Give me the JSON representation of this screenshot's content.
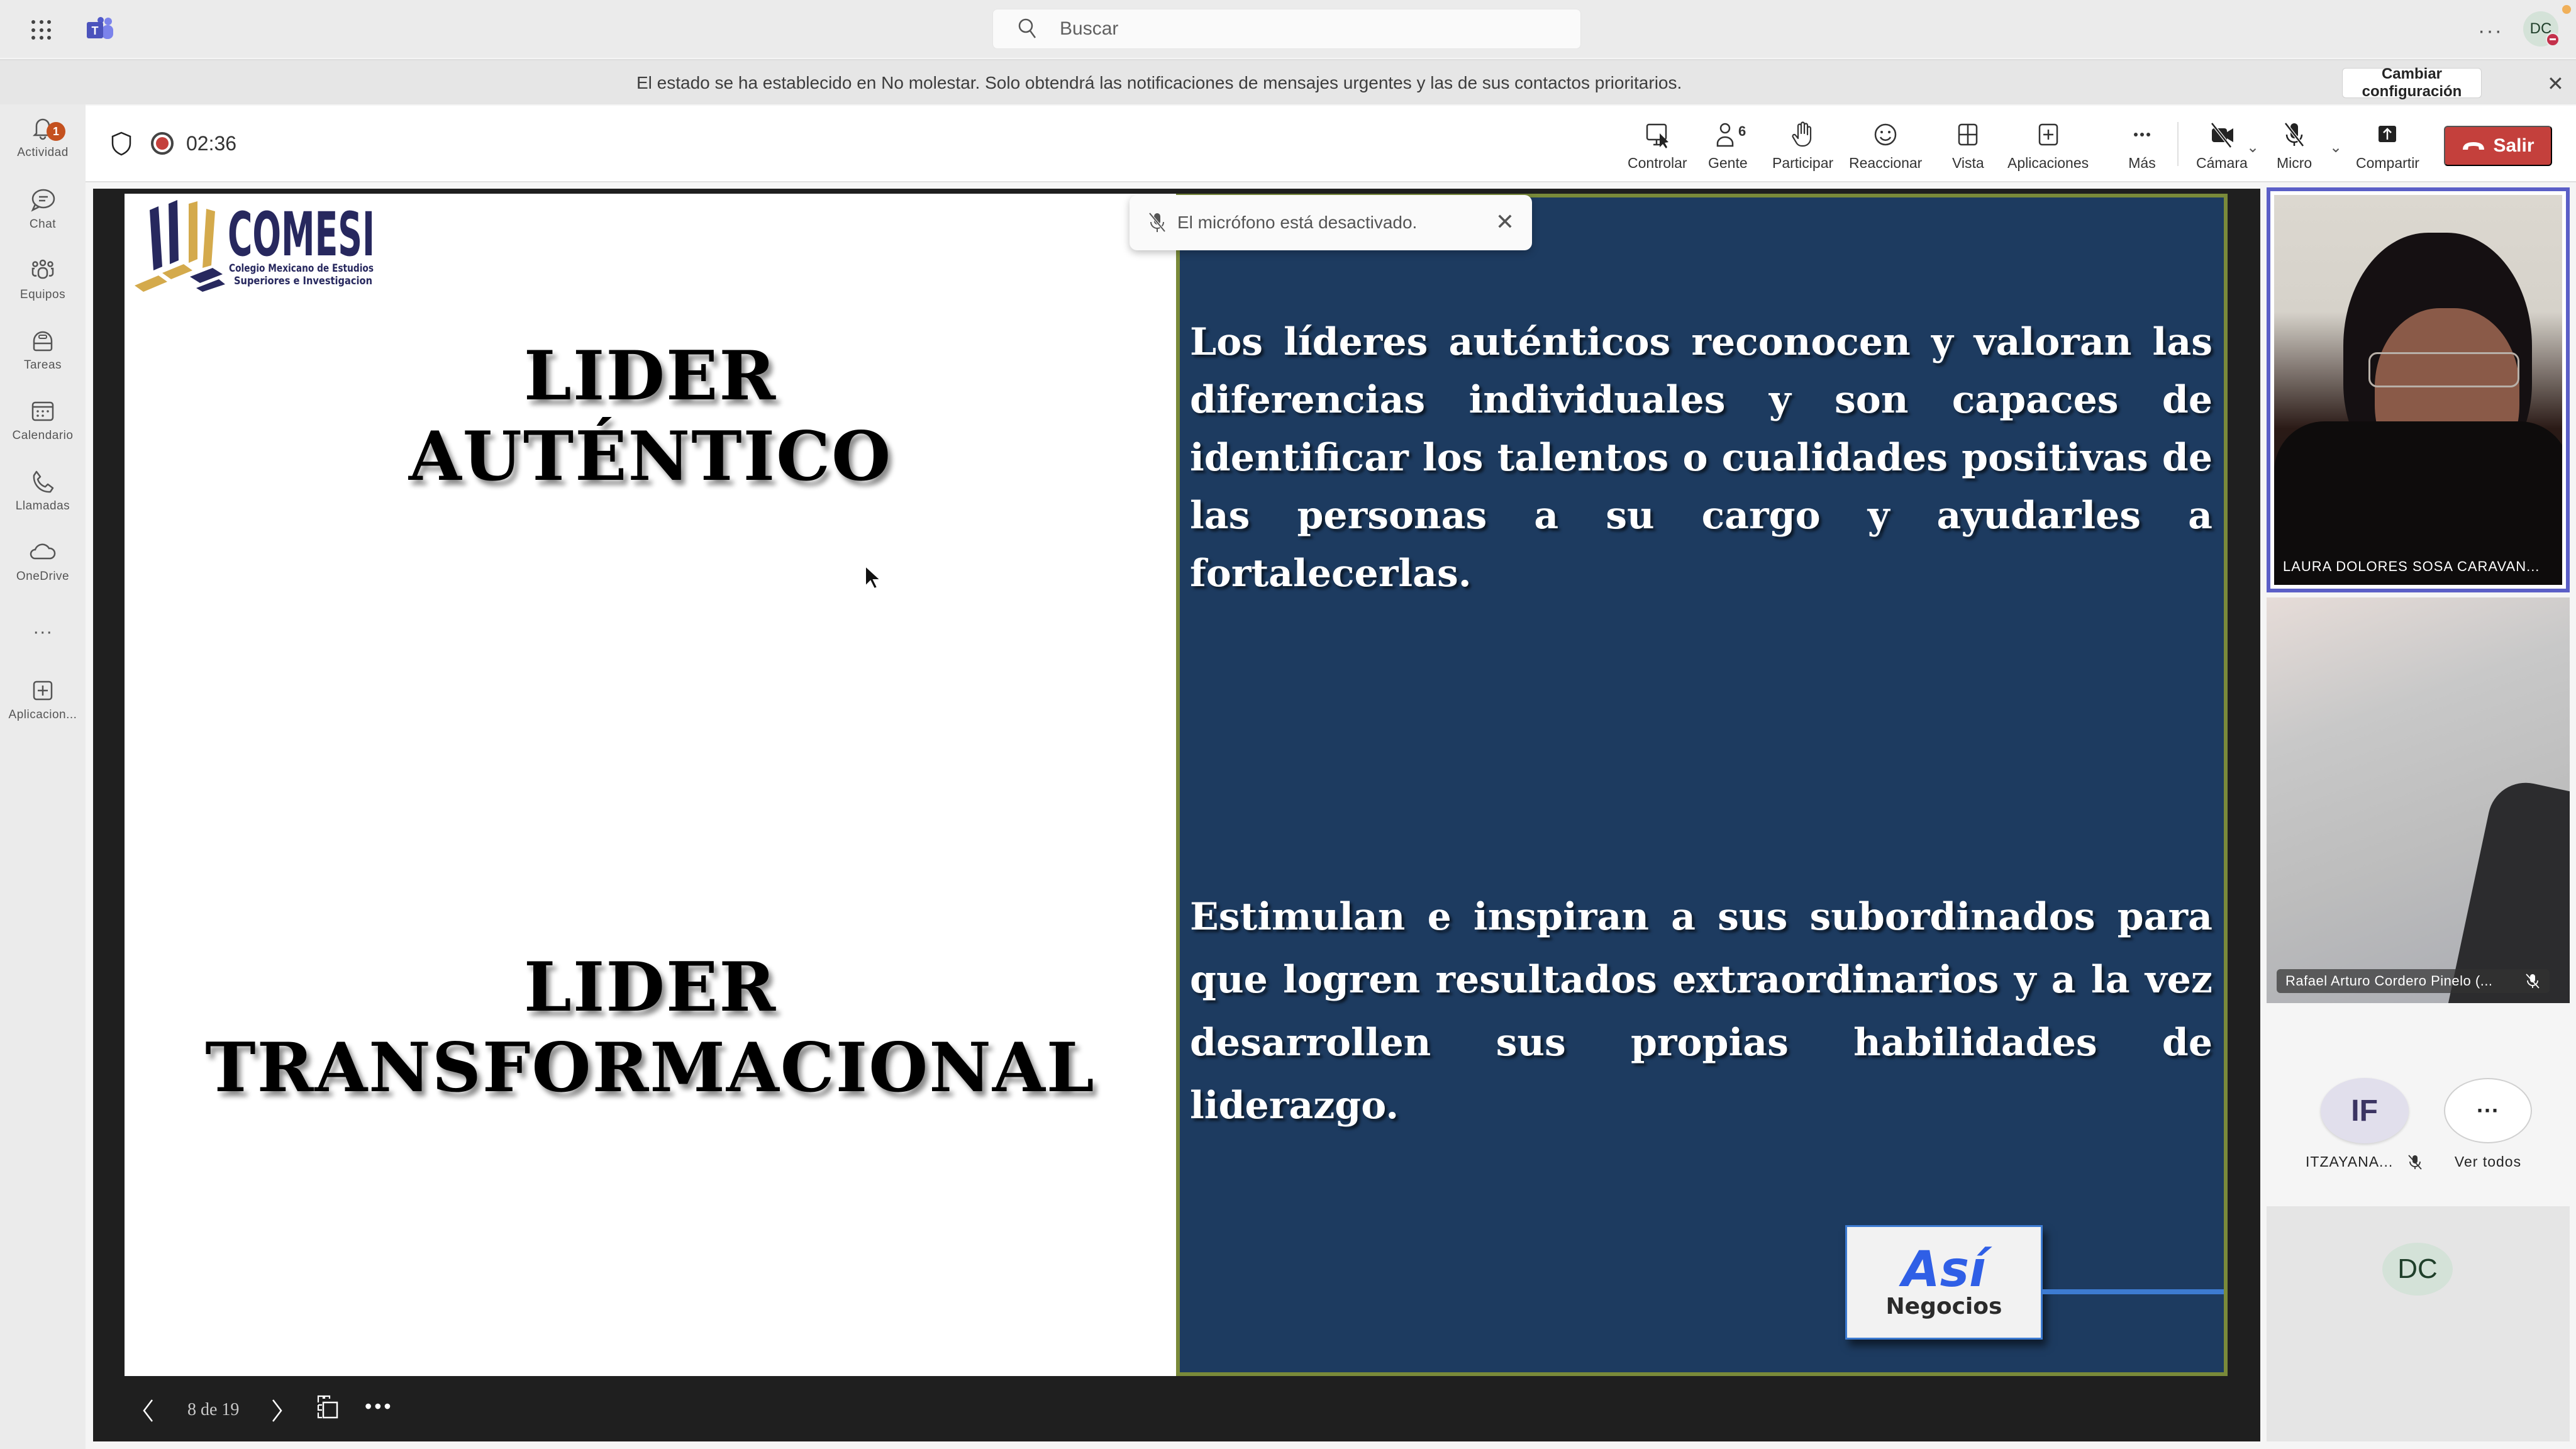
{
  "app": {
    "search_placeholder": "Buscar",
    "user_initials": "DC",
    "more_label": "···"
  },
  "banner": {
    "text": "El estado se ha establecido en No molestar. Solo obtendrá las notificaciones de mensajes urgentes y las de sus contactos prioritarios.",
    "button": "Cambiar configuración",
    "close": "✕"
  },
  "rail": {
    "items": [
      {
        "label": "Actividad",
        "icon": "bell-icon",
        "badge": "1"
      },
      {
        "label": "Chat",
        "icon": "chat-icon"
      },
      {
        "label": "Equipos",
        "icon": "teams-icon"
      },
      {
        "label": "Tareas",
        "icon": "tasks-icon"
      },
      {
        "label": "Calendario",
        "icon": "calendar-icon"
      },
      {
        "label": "Llamadas",
        "icon": "phone-icon"
      },
      {
        "label": "OneDrive",
        "icon": "cloud-icon"
      },
      {
        "label": "···",
        "icon": "more-icon"
      },
      {
        "label": "Aplicacion...",
        "icon": "add-apps-icon"
      }
    ]
  },
  "meeting": {
    "timer": "02:36",
    "people_count": "6",
    "toolbar": [
      {
        "label": "Controlar",
        "icon": "take-control-icon"
      },
      {
        "label": "Gente",
        "icon": "people-icon"
      },
      {
        "label": "Participar",
        "icon": "raise-hand-icon"
      },
      {
        "label": "Reaccionar",
        "icon": "react-icon"
      },
      {
        "label": "Vista",
        "icon": "view-icon"
      },
      {
        "label": "Aplicaciones",
        "icon": "apps-icon"
      },
      {
        "label": "Más",
        "icon": "more-icon"
      },
      {
        "label": "Cámara",
        "icon": "camera-off-icon"
      },
      {
        "label": "Micro",
        "icon": "mic-off-icon"
      },
      {
        "label": "Compartir",
        "icon": "share-icon"
      }
    ],
    "leave_label": "Salir",
    "colors": {
      "leave": "#c4403c",
      "active_speaker": "#5b5fc7"
    }
  },
  "toast": {
    "text": "El micrófono está desactivado."
  },
  "slide": {
    "title1_line1": "LIDER",
    "title1_line2": "AUTÉNTICO",
    "title2_line1": "LIDER",
    "title2_line2": "TRANSFORMACIONAL",
    "paragraph1": "Los líderes auténticos reconocen  y valoran las diferencias individuales y son capaces de identificar  los talentos o cualidades positivas de las personas a su cargo y  ayudarles a fortalecerlas.",
    "paragraph2": "Estimulan e inspiran a sus subordinados para que logren resultados  extraordinarios y a la vez desarrollen sus propias habilidades de liderazgo.",
    "logo_name": "COMESI",
    "logo_subtitle1": "Colegio Mexicano de Estudios",
    "logo_subtitle2": "Superiores e Investigacion",
    "badge_logo_top": "Así",
    "badge_logo_bottom": "Negocios",
    "colors": {
      "panel": "#1d3b60",
      "border": "#7a8a3a",
      "logo_navy": "#27285e",
      "logo_gold": "#d4aa4c"
    },
    "current_page": 8,
    "total_pages": 19,
    "counter": "8 de 19"
  },
  "participants": {
    "tiles": [
      {
        "name": "LAURA DOLORES SOSA CARAVAN...",
        "speaking": true
      },
      {
        "name": "Rafael Arturo Cordero Pinelo (...",
        "muted": true
      }
    ],
    "roster": [
      {
        "initials": "IF",
        "name": "ITZAYANA...",
        "muted": true
      },
      {
        "initials": "···",
        "name": "Ver todos"
      }
    ],
    "self_initials": "DC"
  }
}
